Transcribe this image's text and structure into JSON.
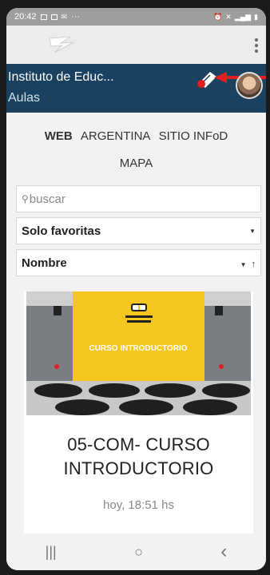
{
  "status_bar": {
    "time": "20:42",
    "extra": "···"
  },
  "header": {
    "institute_name": "Instituto de Educ...",
    "section": "Aulas"
  },
  "links": {
    "web_bold": "WEB",
    "argentina": "ARGENTINA",
    "sitio": "SITIO INFoD",
    "mapa": "MAPA"
  },
  "search": {
    "placeholder": "buscar"
  },
  "filter": {
    "selected": "Solo favoritas"
  },
  "sort": {
    "selected": "Nombre"
  },
  "course_card": {
    "banner_text": "CURSO INTRODUCTORIO",
    "title_line1": "05-COM- CURSO",
    "title_line2": "INTRODUCTORIO",
    "date": "hoy, 18:51 hs"
  },
  "nav": {
    "recents": "|||",
    "home": "○",
    "back": "‹"
  },
  "colors": {
    "header_bg": "#1b4161",
    "accent_red": "#e02020",
    "banner_yellow": "#f4c61f"
  }
}
